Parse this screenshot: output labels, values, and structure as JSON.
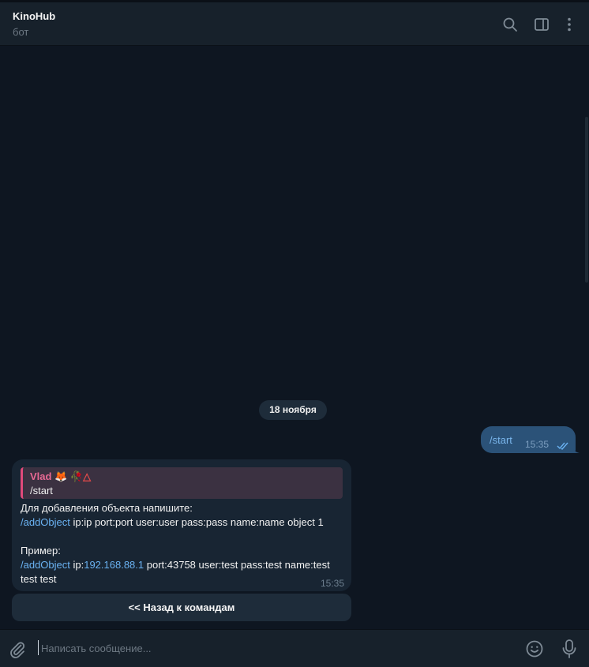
{
  "header": {
    "title": "KinoHub",
    "subtitle": "бот",
    "icons": [
      "search-icon",
      "sidebar-toggle-icon",
      "more-vertical-icon"
    ]
  },
  "date_separator": "18 ноября",
  "outgoing": {
    "text": "/start",
    "time": "15:35",
    "status": "read"
  },
  "incoming": {
    "reply_author": "Vlad",
    "reply_author_emoji": "🦊 🥀",
    "reply_author_symbol": "△",
    "reply_text": "/start",
    "line1": "Для добавления объекта напишите:",
    "line2_cmd": "/addObject",
    "line2_rest": " ip:ip port:port user:user pass:pass name:name object 1",
    "line3": "Пример:",
    "line4_cmd": "/addObject",
    "line4_ip_prefix": " ip:",
    "line4_ip": "192.168.88.1",
    "line4_rest": " port:43758 user:test pass:test name:test",
    "line5": "test test",
    "time": "15:35"
  },
  "keyboard": {
    "button_label": "<< Назад к командам"
  },
  "composer": {
    "placeholder": "Написать сообщение...",
    "value": ""
  },
  "colors": {
    "background": "#0e1621",
    "panel": "#17212b",
    "outgoing_bubble": "#2b5278",
    "incoming_bubble": "#182533",
    "link": "#6ab2f2",
    "reply_accent": "#e24a7b"
  }
}
